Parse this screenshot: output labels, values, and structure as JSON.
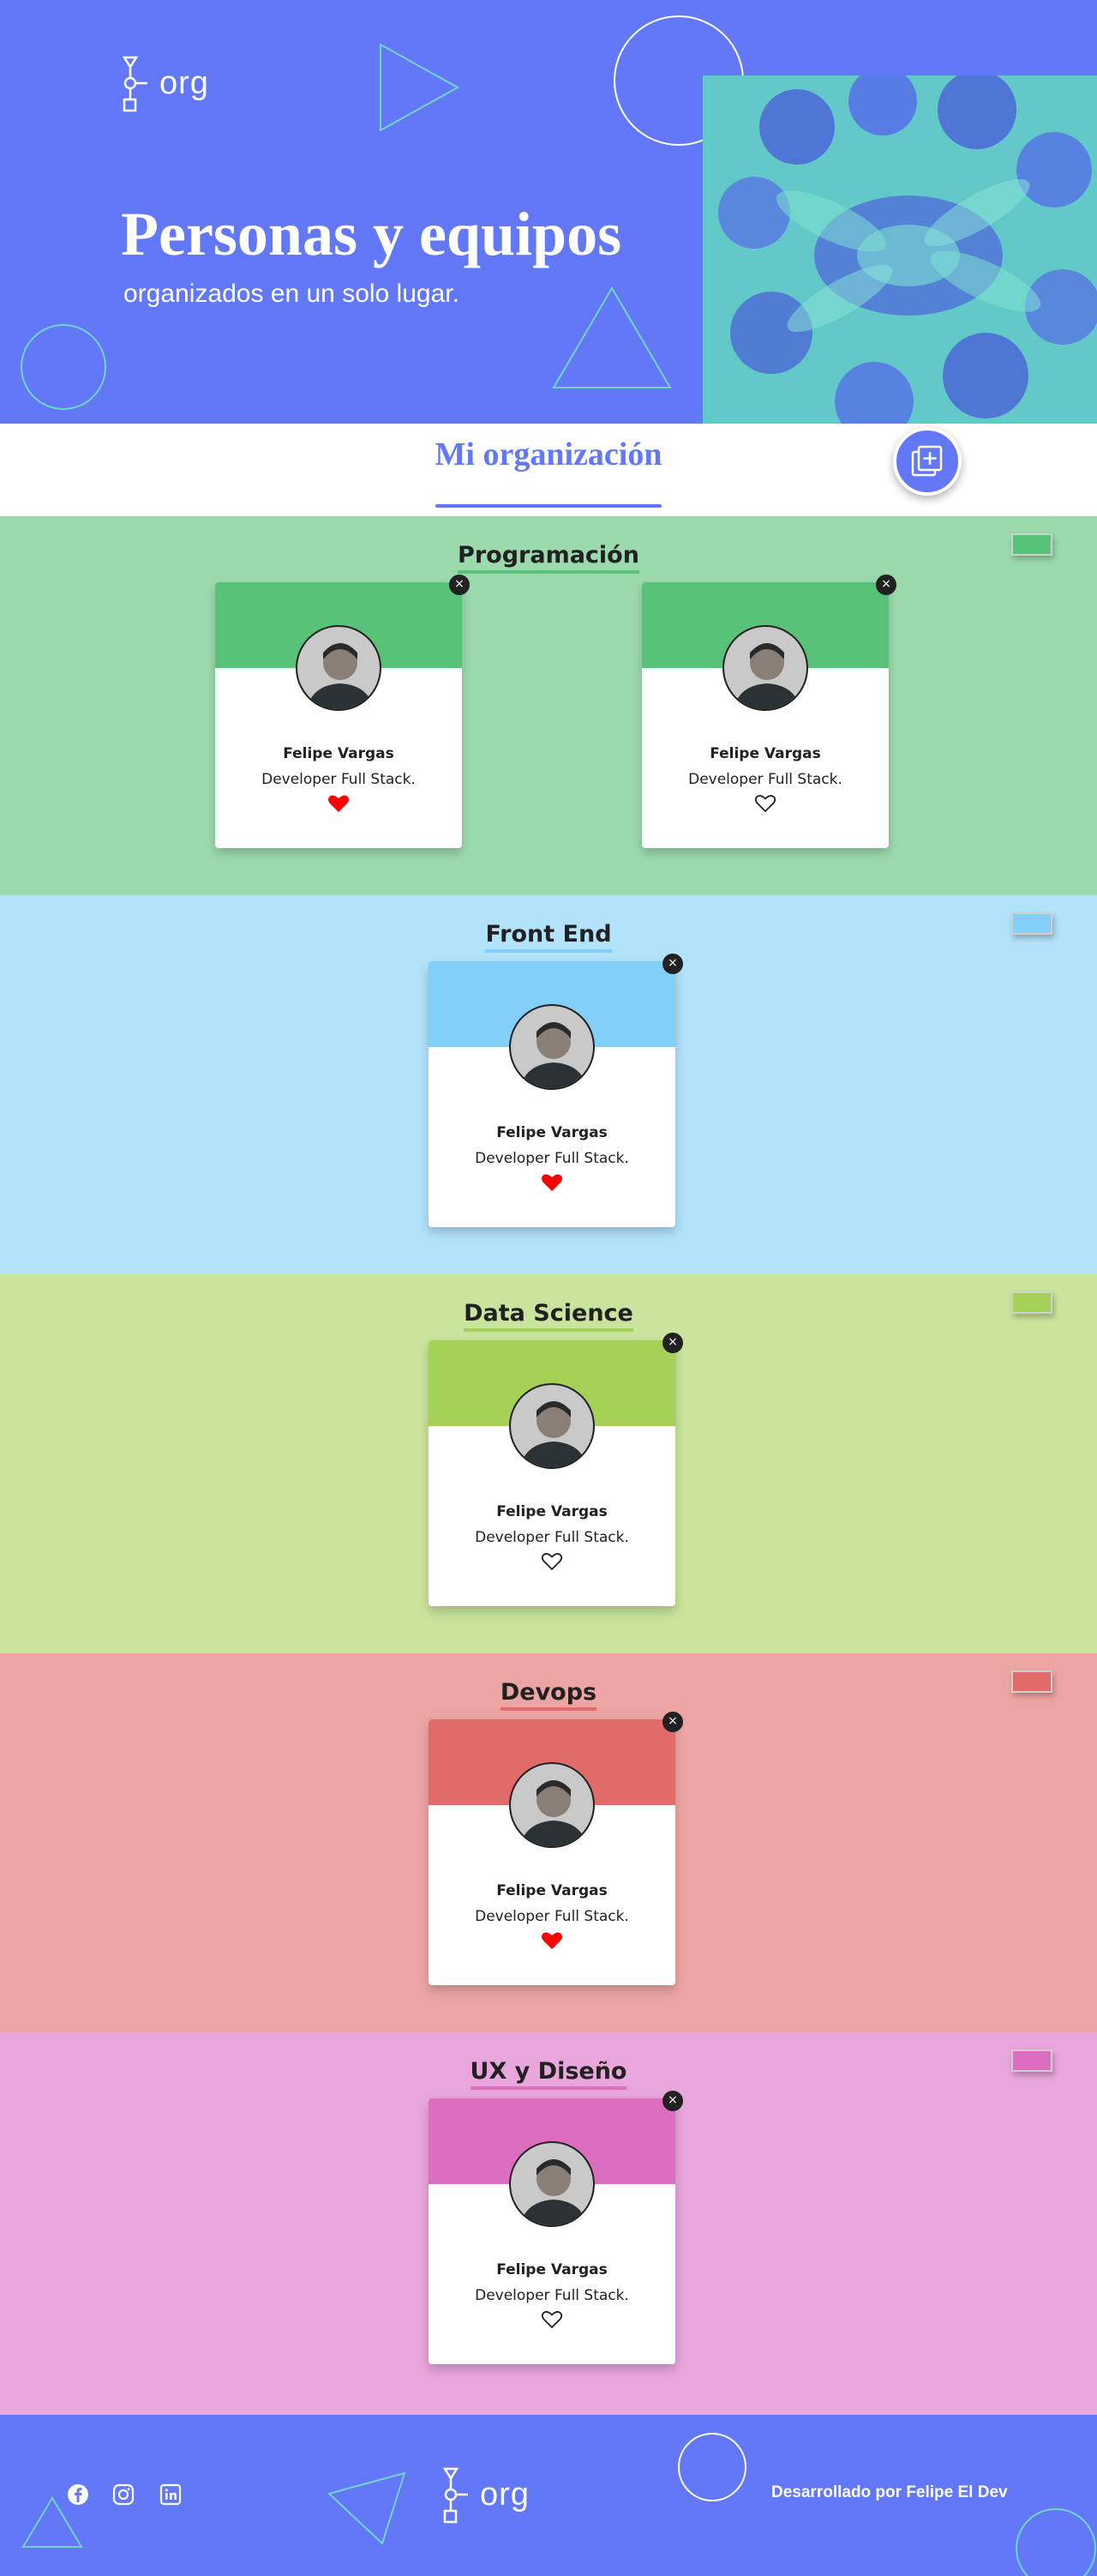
{
  "header": {
    "logo_text": "org",
    "title": "Personas y equipos",
    "subtitle": "organizados en un solo lugar."
  },
  "org_section": {
    "title": "Mi organización",
    "add_button_icon": "add-collaborator-icon"
  },
  "teams": [
    {
      "name": "Programación",
      "primary_color": "#57c278",
      "secondary_color": "#9cdaad",
      "members": [
        {
          "name": "Felipe Vargas",
          "role": "Developer Full Stack.",
          "favorite": true
        },
        {
          "name": "Felipe Vargas",
          "role": "Developer Full Stack.",
          "favorite": false
        }
      ]
    },
    {
      "name": "Front End",
      "primary_color": "#82cffa",
      "secondary_color": "#b3e2fb",
      "members": [
        {
          "name": "Felipe Vargas",
          "role": "Developer Full Stack.",
          "favorite": true
        }
      ]
    },
    {
      "name": "Data Science",
      "primary_color": "#a6d157",
      "secondary_color": "#c9e49c",
      "members": [
        {
          "name": "Felipe Vargas",
          "role": "Developer Full Stack.",
          "favorite": false
        }
      ]
    },
    {
      "name": "Devops",
      "primary_color": "#e06b69",
      "secondary_color": "#eda5a3",
      "members": [
        {
          "name": "Felipe Vargas",
          "role": "Developer Full Stack.",
          "favorite": true
        }
      ]
    },
    {
      "name": "UX y Diseño",
      "primary_color": "#db6ebf",
      "secondary_color": "#e9a6dd",
      "members": [
        {
          "name": "Felipe Vargas",
          "role": "Developer Full Stack.",
          "favorite": false
        }
      ]
    }
  ],
  "card": {
    "delete_symbol": "×"
  },
  "footer": {
    "social_icons": [
      "facebook-icon",
      "instagram-icon",
      "linkedin-icon"
    ],
    "logo_text": "org",
    "credit": "Desarrollado por Felipe El Dev"
  },
  "colors": {
    "brand": "#6278f7",
    "accent_outline": "#6dd6cc",
    "heart_active": "#ff0000"
  }
}
